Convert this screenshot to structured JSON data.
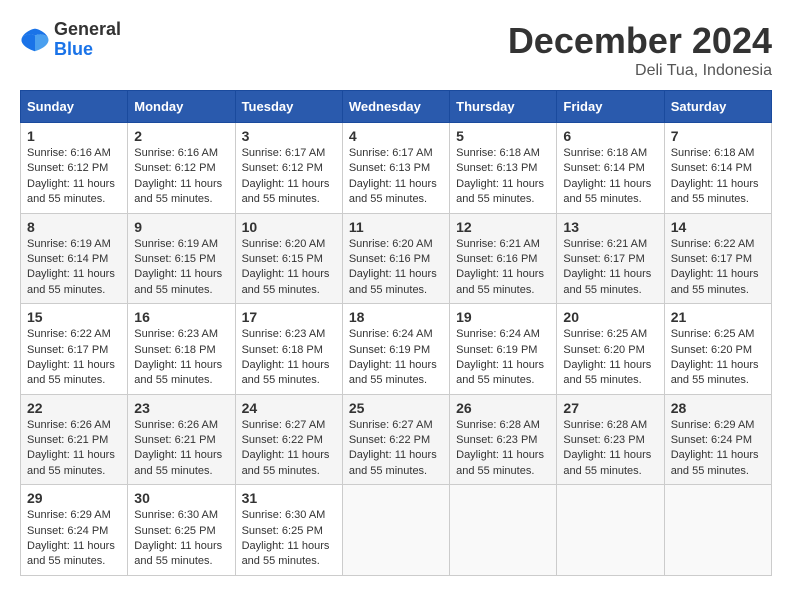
{
  "header": {
    "logo_general": "General",
    "logo_blue": "Blue",
    "month_title": "December 2024",
    "location": "Deli Tua, Indonesia"
  },
  "weekdays": [
    "Sunday",
    "Monday",
    "Tuesday",
    "Wednesday",
    "Thursday",
    "Friday",
    "Saturday"
  ],
  "weeks": [
    [
      {
        "day": "1",
        "sunrise": "6:16 AM",
        "sunset": "6:12 PM",
        "daylight": "11 hours and 55 minutes."
      },
      {
        "day": "2",
        "sunrise": "6:16 AM",
        "sunset": "6:12 PM",
        "daylight": "11 hours and 55 minutes."
      },
      {
        "day": "3",
        "sunrise": "6:17 AM",
        "sunset": "6:12 PM",
        "daylight": "11 hours and 55 minutes."
      },
      {
        "day": "4",
        "sunrise": "6:17 AM",
        "sunset": "6:13 PM",
        "daylight": "11 hours and 55 minutes."
      },
      {
        "day": "5",
        "sunrise": "6:18 AM",
        "sunset": "6:13 PM",
        "daylight": "11 hours and 55 minutes."
      },
      {
        "day": "6",
        "sunrise": "6:18 AM",
        "sunset": "6:14 PM",
        "daylight": "11 hours and 55 minutes."
      },
      {
        "day": "7",
        "sunrise": "6:18 AM",
        "sunset": "6:14 PM",
        "daylight": "11 hours and 55 minutes."
      }
    ],
    [
      {
        "day": "8",
        "sunrise": "6:19 AM",
        "sunset": "6:14 PM",
        "daylight": "11 hours and 55 minutes."
      },
      {
        "day": "9",
        "sunrise": "6:19 AM",
        "sunset": "6:15 PM",
        "daylight": "11 hours and 55 minutes."
      },
      {
        "day": "10",
        "sunrise": "6:20 AM",
        "sunset": "6:15 PM",
        "daylight": "11 hours and 55 minutes."
      },
      {
        "day": "11",
        "sunrise": "6:20 AM",
        "sunset": "6:16 PM",
        "daylight": "11 hours and 55 minutes."
      },
      {
        "day": "12",
        "sunrise": "6:21 AM",
        "sunset": "6:16 PM",
        "daylight": "11 hours and 55 minutes."
      },
      {
        "day": "13",
        "sunrise": "6:21 AM",
        "sunset": "6:17 PM",
        "daylight": "11 hours and 55 minutes."
      },
      {
        "day": "14",
        "sunrise": "6:22 AM",
        "sunset": "6:17 PM",
        "daylight": "11 hours and 55 minutes."
      }
    ],
    [
      {
        "day": "15",
        "sunrise": "6:22 AM",
        "sunset": "6:17 PM",
        "daylight": "11 hours and 55 minutes."
      },
      {
        "day": "16",
        "sunrise": "6:23 AM",
        "sunset": "6:18 PM",
        "daylight": "11 hours and 55 minutes."
      },
      {
        "day": "17",
        "sunrise": "6:23 AM",
        "sunset": "6:18 PM",
        "daylight": "11 hours and 55 minutes."
      },
      {
        "day": "18",
        "sunrise": "6:24 AM",
        "sunset": "6:19 PM",
        "daylight": "11 hours and 55 minutes."
      },
      {
        "day": "19",
        "sunrise": "6:24 AM",
        "sunset": "6:19 PM",
        "daylight": "11 hours and 55 minutes."
      },
      {
        "day": "20",
        "sunrise": "6:25 AM",
        "sunset": "6:20 PM",
        "daylight": "11 hours and 55 minutes."
      },
      {
        "day": "21",
        "sunrise": "6:25 AM",
        "sunset": "6:20 PM",
        "daylight": "11 hours and 55 minutes."
      }
    ],
    [
      {
        "day": "22",
        "sunrise": "6:26 AM",
        "sunset": "6:21 PM",
        "daylight": "11 hours and 55 minutes."
      },
      {
        "day": "23",
        "sunrise": "6:26 AM",
        "sunset": "6:21 PM",
        "daylight": "11 hours and 55 minutes."
      },
      {
        "day": "24",
        "sunrise": "6:27 AM",
        "sunset": "6:22 PM",
        "daylight": "11 hours and 55 minutes."
      },
      {
        "day": "25",
        "sunrise": "6:27 AM",
        "sunset": "6:22 PM",
        "daylight": "11 hours and 55 minutes."
      },
      {
        "day": "26",
        "sunrise": "6:28 AM",
        "sunset": "6:23 PM",
        "daylight": "11 hours and 55 minutes."
      },
      {
        "day": "27",
        "sunrise": "6:28 AM",
        "sunset": "6:23 PM",
        "daylight": "11 hours and 55 minutes."
      },
      {
        "day": "28",
        "sunrise": "6:29 AM",
        "sunset": "6:24 PM",
        "daylight": "11 hours and 55 minutes."
      }
    ],
    [
      {
        "day": "29",
        "sunrise": "6:29 AM",
        "sunset": "6:24 PM",
        "daylight": "11 hours and 55 minutes."
      },
      {
        "day": "30",
        "sunrise": "6:30 AM",
        "sunset": "6:25 PM",
        "daylight": "11 hours and 55 minutes."
      },
      {
        "day": "31",
        "sunrise": "6:30 AM",
        "sunset": "6:25 PM",
        "daylight": "11 hours and 55 minutes."
      },
      null,
      null,
      null,
      null
    ]
  ]
}
